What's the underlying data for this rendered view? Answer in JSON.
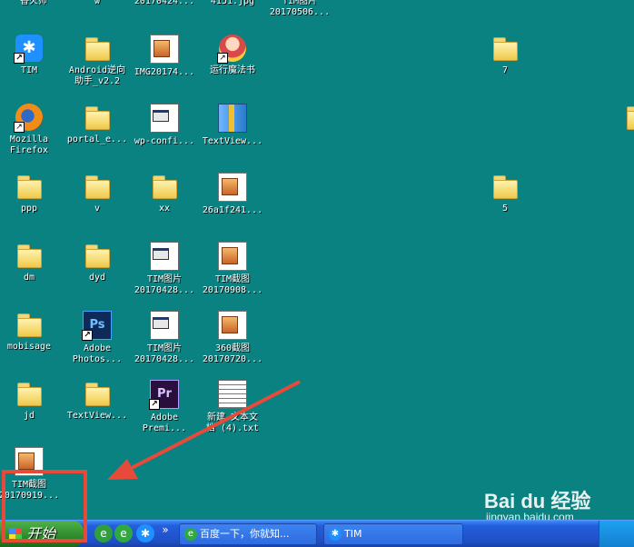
{
  "desktop": {
    "top_partial": [
      "香火师",
      "w",
      "20170424...",
      "4151.jpg",
      "TIM图片\n20170506..."
    ],
    "icons": [
      {
        "id": "tim",
        "label": "TIM",
        "glyph": "tim-app",
        "shortcut": true,
        "symbol": "✱"
      },
      {
        "id": "android-assistant",
        "label": "Android逆向\n助手_v2.2",
        "glyph": "folder"
      },
      {
        "id": "img2017",
        "label": "IMG20174...",
        "glyph": "img-file"
      },
      {
        "id": "magic-book",
        "label": "运行魔法书",
        "glyph": "anime-app",
        "shortcut": true
      },
      {
        "id": "folder-7",
        "label": "7",
        "glyph": "folder"
      },
      {
        "id": "firefox",
        "label": "Mozilla\nFirefox",
        "glyph": "ff-app",
        "shortcut": true
      },
      {
        "id": "portal",
        "label": "portal_e...",
        "glyph": "folder"
      },
      {
        "id": "wp-config",
        "label": "wp-confi...",
        "glyph": "doc-file"
      },
      {
        "id": "textview-archive",
        "label": "TextView...",
        "glyph": "archive-file"
      },
      {
        "id": "ppp",
        "label": "ppp",
        "glyph": "folder"
      },
      {
        "id": "v",
        "label": "v",
        "glyph": "folder"
      },
      {
        "id": "xx",
        "label": "xx",
        "glyph": "folder"
      },
      {
        "id": "26a1f",
        "label": "26a1f241...",
        "glyph": "img-file"
      },
      {
        "id": "folder-5",
        "label": "5",
        "glyph": "folder"
      },
      {
        "id": "dm",
        "label": "dm",
        "glyph": "folder"
      },
      {
        "id": "dyd",
        "label": "dyd",
        "glyph": "folder"
      },
      {
        "id": "tim-pic-1",
        "label": "TIM图片\n20170428...",
        "glyph": "doc-file"
      },
      {
        "id": "tim-shot-1",
        "label": "TIM截图\n20170908...",
        "glyph": "img-file"
      },
      {
        "id": "mobisage",
        "label": "mobisage",
        "glyph": "folder"
      },
      {
        "id": "photoshop",
        "label": "Adobe\nPhotos...",
        "glyph": "ps-app",
        "shortcut": true,
        "symbol": "Ps"
      },
      {
        "id": "tim-pic-2",
        "label": "TIM图片\n20170428...",
        "glyph": "doc-file"
      },
      {
        "id": "shot-360",
        "label": "360截图\n20170720...",
        "glyph": "img-file"
      },
      {
        "id": "jd",
        "label": "jd",
        "glyph": "folder"
      },
      {
        "id": "textview-folder",
        "label": "TextView...",
        "glyph": "folder"
      },
      {
        "id": "premiere",
        "label": "Adobe\nPremi...",
        "glyph": "pr-app",
        "shortcut": true,
        "symbol": "Pr"
      },
      {
        "id": "new-txt",
        "label": "新建 文本文\n档 (4).txt",
        "glyph": "txt-file"
      },
      {
        "id": "tim-shot-2",
        "label": "TIM截图\n20170919...",
        "glyph": "img-file"
      }
    ]
  },
  "taskbar": {
    "start_label": "开始",
    "quick_launch": [
      {
        "name": "ie-icon",
        "symbol": "e",
        "color": "#2f9e3e"
      },
      {
        "name": "browser-icon",
        "symbol": "e",
        "color": "#2faa40"
      },
      {
        "name": "tim-quick-icon",
        "symbol": "✱",
        "color": "#1e90ff"
      }
    ],
    "overflow": "»",
    "tasks": [
      {
        "label": "百度一下，你就知...",
        "symbol": "e",
        "color": "#2faa40"
      },
      {
        "label": "TIM",
        "symbol": "✱",
        "color": "#1e90ff"
      }
    ]
  },
  "annotation": {
    "color": "#e84a3a"
  },
  "watermark": {
    "brand": "Bai du 经验",
    "url": "jingyan.baidu.com"
  }
}
